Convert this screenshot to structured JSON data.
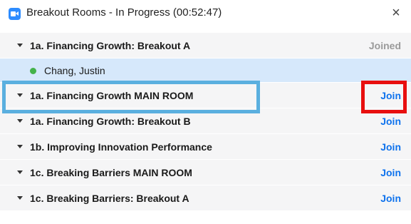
{
  "window": {
    "title": "Breakout Rooms - In Progress (00:52:47)",
    "close_label": "×"
  },
  "rooms": [
    {
      "name": "1a. Financing Growth: Breakout A",
      "action": "Joined"
    },
    {
      "name": "1a. Financing Growth MAIN ROOM",
      "action": "Join"
    },
    {
      "name": "1a. Financing Growth: Breakout B",
      "action": "Join"
    },
    {
      "name": "1b. Improving Innovation Performance",
      "action": "Join"
    },
    {
      "name": "1c. Breaking Barriers MAIN ROOM",
      "action": "Join"
    },
    {
      "name": "1c. Breaking Barriers: Breakout A",
      "action": "Join"
    }
  ],
  "participants": [
    {
      "name": "Chang, Justin",
      "status_color": "#44b24a"
    }
  ],
  "colors": {
    "accent": "#0e72ed",
    "highlight_blue": "#5aafdf",
    "highlight_red": "#e80f0f",
    "member_row": "#d6e8fb"
  }
}
